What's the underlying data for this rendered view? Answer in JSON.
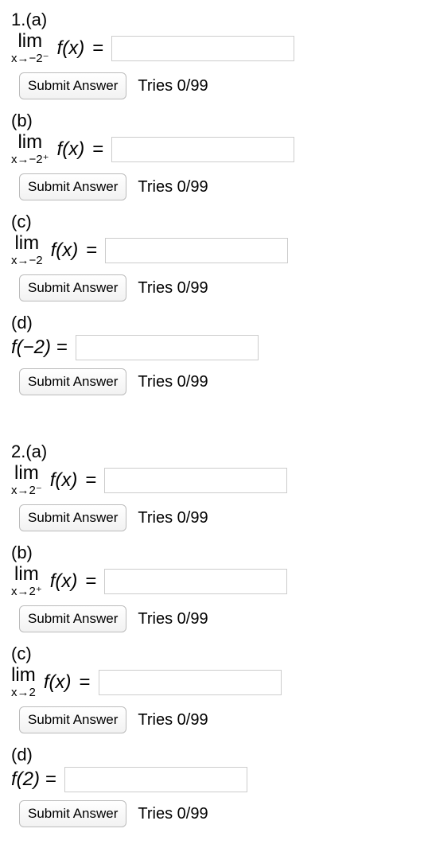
{
  "q1": {
    "heading": "1.(a)",
    "parts": {
      "a": {
        "label": "1.(a)",
        "lim_top": "lim",
        "lim_bot": "x→−2⁻",
        "fx": "f(x)",
        "eq": "=",
        "submit": "Submit Answer",
        "tries": "Tries 0/99"
      },
      "b": {
        "label": "(b)",
        "lim_top": "lim",
        "lim_bot": "x→−2⁺",
        "fx": "f(x)",
        "eq": "=",
        "submit": "Submit Answer",
        "tries": "Tries 0/99"
      },
      "c": {
        "label": "(c)",
        "lim_top": "lim",
        "lim_bot": "x→−2",
        "fx": "f(x)",
        "eq": "=",
        "submit": "Submit Answer",
        "tries": "Tries 0/99"
      },
      "d": {
        "label": "(d)",
        "expr": "f(−2) =",
        "submit": "Submit Answer",
        "tries": "Tries 0/99"
      }
    }
  },
  "q2": {
    "parts": {
      "a": {
        "label": "2.(a)",
        "lim_top": "lim",
        "lim_bot": "x→2⁻",
        "fx": "f(x)",
        "eq": "=",
        "submit": "Submit Answer",
        "tries": "Tries 0/99"
      },
      "b": {
        "label": "(b)",
        "lim_top": "lim",
        "lim_bot": "x→2⁺",
        "fx": "f(x)",
        "eq": "=",
        "submit": "Submit Answer",
        "tries": "Tries 0/99"
      },
      "c": {
        "label": "(c)",
        "lim_top": "lim",
        "lim_bot": "x→2",
        "fx": "f(x)",
        "eq": "=",
        "submit": "Submit Answer",
        "tries": "Tries 0/99"
      },
      "d": {
        "label": "(d)",
        "expr": "f(2) =",
        "submit": "Submit Answer",
        "tries": "Tries 0/99"
      }
    }
  }
}
